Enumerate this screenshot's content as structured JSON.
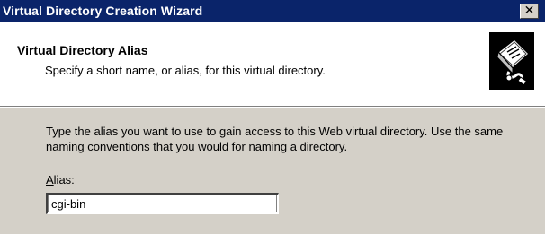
{
  "window": {
    "title": "Virtual Directory Creation Wizard",
    "close_symbol": "✕"
  },
  "header": {
    "title": "Virtual Directory Alias",
    "subtitle": "Specify a short name, or alias, for this virtual directory.",
    "icon": "wizard-book-icon"
  },
  "body": {
    "instructions": "Type the alias you want to use to gain access to this Web virtual directory. Use the same naming conventions that you would for naming a directory.",
    "alias_label_accesskey": "A",
    "alias_label_rest": "lias:",
    "alias_value": "cgi-bin"
  },
  "colors": {
    "titlebar": "#0a246a",
    "dialog_face": "#d4d0c8",
    "header_bg": "#ffffff"
  }
}
